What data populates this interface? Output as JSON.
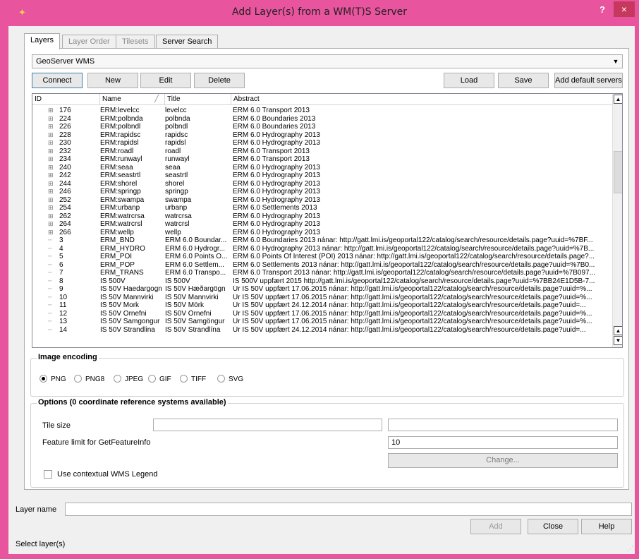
{
  "window": {
    "title": "Add Layer(s) from a WM(T)S Server",
    "help_label": "?",
    "close_label": "×"
  },
  "tabs": [
    {
      "label": "Layers",
      "state": "active"
    },
    {
      "label": "Layer Order",
      "state": "disabled"
    },
    {
      "label": "Tilesets",
      "state": "disabled"
    },
    {
      "label": "Server Search",
      "state": "normal"
    }
  ],
  "server": {
    "selected": "GeoServer WMS"
  },
  "buttons": {
    "connect": "Connect",
    "new": "New",
    "edit": "Edit",
    "delete": "Delete",
    "load": "Load",
    "save": "Save",
    "add_default": "Add default servers"
  },
  "tree": {
    "columns": [
      "ID",
      "Name",
      "Title",
      "Abstract"
    ],
    "sort_indicator": "╱",
    "rows": [
      {
        "exp": "⊞",
        "id": "176",
        "name": "ERM:levelcc",
        "title": "levelcc",
        "abstract": "ERM 6.0 Transport 2013"
      },
      {
        "exp": "⊞",
        "id": "224",
        "name": "ERM:polbnda",
        "title": "polbnda",
        "abstract": "ERM 6.0 Boundaries 2013"
      },
      {
        "exp": "⊞",
        "id": "226",
        "name": "ERM:polbndl",
        "title": "polbndl",
        "abstract": "ERM 6.0 Boundaries 2013"
      },
      {
        "exp": "⊞",
        "id": "228",
        "name": "ERM:rapidsc",
        "title": "rapidsc",
        "abstract": "ERM 6.0 Hydrography 2013"
      },
      {
        "exp": "⊞",
        "id": "230",
        "name": "ERM:rapidsl",
        "title": "rapidsl",
        "abstract": "ERM 6.0 Hydrography 2013"
      },
      {
        "exp": "⊞",
        "id": "232",
        "name": "ERM:roadl",
        "title": "roadl",
        "abstract": "ERM 6.0 Transport 2013"
      },
      {
        "exp": "⊞",
        "id": "234",
        "name": "ERM:runwayl",
        "title": "runwayl",
        "abstract": "ERM 6.0 Transport 2013"
      },
      {
        "exp": "⊞",
        "id": "240",
        "name": "ERM:seaa",
        "title": "seaa",
        "abstract": "ERM 6.0 Hydrography 2013"
      },
      {
        "exp": "⊞",
        "id": "242",
        "name": "ERM:seastrtl",
        "title": "seastrtl",
        "abstract": "ERM 6.0 Hydrography 2013"
      },
      {
        "exp": "⊞",
        "id": "244",
        "name": "ERM:shorel",
        "title": "shorel",
        "abstract": "ERM 6.0 Hydrography 2013"
      },
      {
        "exp": "⊞",
        "id": "246",
        "name": "ERM:springp",
        "title": "springp",
        "abstract": "ERM 6.0 Hydrography 2013"
      },
      {
        "exp": "⊞",
        "id": "252",
        "name": "ERM:swampa",
        "title": "swampa",
        "abstract": "ERM 6.0 Hydrography 2013"
      },
      {
        "exp": "⊞",
        "id": "254",
        "name": "ERM:urbanp",
        "title": "urbanp",
        "abstract": "ERM 6.0 Settlements 2013"
      },
      {
        "exp": "⊞",
        "id": "262",
        "name": "ERM:watrcrsa",
        "title": "watrcrsa",
        "abstract": "ERM 6.0 Hydrography 2013"
      },
      {
        "exp": "⊞",
        "id": "264",
        "name": "ERM:watrcrsl",
        "title": "watrcrsl",
        "abstract": "ERM 6.0 Hydrography 2013"
      },
      {
        "exp": "⊞",
        "id": "266",
        "name": "ERM:wellp",
        "title": "wellp",
        "abstract": "ERM 6.0 Hydrography 2013"
      },
      {
        "exp": "┈",
        "id": "3",
        "name": "ERM_BND",
        "title": "ERM 6.0 Boundar...",
        "abstract": "ERM 6.0 Boundaries 2013 nánar: http://gatt.lmi.is/geoportal122/catalog/search/resource/details.page?uuid=%7BF..."
      },
      {
        "exp": "┈",
        "id": "4",
        "name": "ERM_HYDRO",
        "title": "ERM 6.0 Hydrogr...",
        "abstract": "ERM 6.0 Hydrography 2013 nánar: http://gatt.lmi.is/geoportal122/catalog/search/resource/details.page?uuid=%7B..."
      },
      {
        "exp": "┈",
        "id": "5",
        "name": "ERM_POI",
        "title": "ERM 6.0 Points O...",
        "abstract": "ERM 6.0 Points Of Interest (POI) 2013 nánar: http://gatt.lmi.is/geoportal122/catalog/search/resource/details.page?..."
      },
      {
        "exp": "┈",
        "id": "6",
        "name": "ERM_POP",
        "title": "ERM 6.0 Settlem...",
        "abstract": "ERM 6.0 Settlements 2013 nánar: http://gatt.lmi.is/geoportal122/catalog/search/resource/details.page?uuid=%7B0..."
      },
      {
        "exp": "┈",
        "id": "7",
        "name": "ERM_TRANS",
        "title": "ERM 6.0 Transpo...",
        "abstract": "ERM 6.0 Transport 2013 nánar: http://gatt.lmi.is/geoportal122/catalog/search/resource/details.page?uuid=%7B097..."
      },
      {
        "exp": "┈",
        "id": "8",
        "name": "IS 500V",
        "title": "IS 500V",
        "abstract": "IS 500V uppfært 2015 http://gatt.lmi.is/geoportal122/catalog/search/resource/details.page?uuid=%7BB24E1D5B-7..."
      },
      {
        "exp": "┈",
        "id": "9",
        "name": "IS 50V Haedargogn",
        "title": "IS 50V Hæðargögn",
        "abstract": "Úr IS 50V uppfært 17.06.2015 nánar: http://gatt.lmi.is/geoportal122/catalog/search/resource/details.page?uuid=%..."
      },
      {
        "exp": "┈",
        "id": "10",
        "name": "IS 50V Mannvirki",
        "title": "IS 50V Mannvirki",
        "abstract": "Úr IS 50V uppfært 17.06.2015 nánar: http://gatt.lmi.is/geoportal122/catalog/search/resource/details.page?uuid=%..."
      },
      {
        "exp": "┈",
        "id": "11",
        "name": "IS 50V Mork",
        "title": "IS 50V Mörk",
        "abstract": "Úr IS 50V uppfært 24.12.2014 nánar: http://gatt.lmi.is/geoportal122/catalog/search/resource/details.page?uuid=..."
      },
      {
        "exp": "┈",
        "id": "12",
        "name": "IS 50V Ornefni",
        "title": "IS 50V Örnefni",
        "abstract": "Úr IS 50V uppfært 17.06.2015 nánar: http://gatt.lmi.is/geoportal122/catalog/search/resource/details.page?uuid=%..."
      },
      {
        "exp": "┈",
        "id": "13",
        "name": "IS 50V Samgongur",
        "title": "IS 50V Samgöngur",
        "abstract": "Úr IS 50V uppfært 17.06.2015 nánar: http://gatt.lmi.is/geoportal122/catalog/search/resource/details.page?uuid=%..."
      },
      {
        "exp": "┈",
        "id": "14",
        "name": "IS 50V Strandlina",
        "title": "IS 50V Strandlína",
        "abstract": "Úr IS 50V uppfært 24.12.2014 nánar: http://gatt.lmi.is/geoportal122/catalog/search/resource/details.page?uuid=..."
      }
    ]
  },
  "encoding": {
    "title": "Image encoding",
    "options": [
      "PNG",
      "PNG8",
      "JPEG",
      "GIF",
      "TIFF",
      "SVG"
    ],
    "selected": "PNG"
  },
  "options": {
    "title": "Options (0 coordinate reference systems available)",
    "tile_size_label": "Tile size",
    "tile_size_value": "",
    "feature_limit_label": "Feature limit for GetFeatureInfo",
    "feature_limit_value": "10",
    "change_label": "Change...",
    "legend_label": "Use contextual WMS Legend"
  },
  "layer_name": {
    "label": "Layer name",
    "value": ""
  },
  "footer": {
    "add": "Add",
    "close": "Close",
    "help": "Help",
    "status": "Select layer(s)"
  },
  "colors": {
    "titlebar": "#e8549d",
    "close_button": "#c7385f"
  }
}
